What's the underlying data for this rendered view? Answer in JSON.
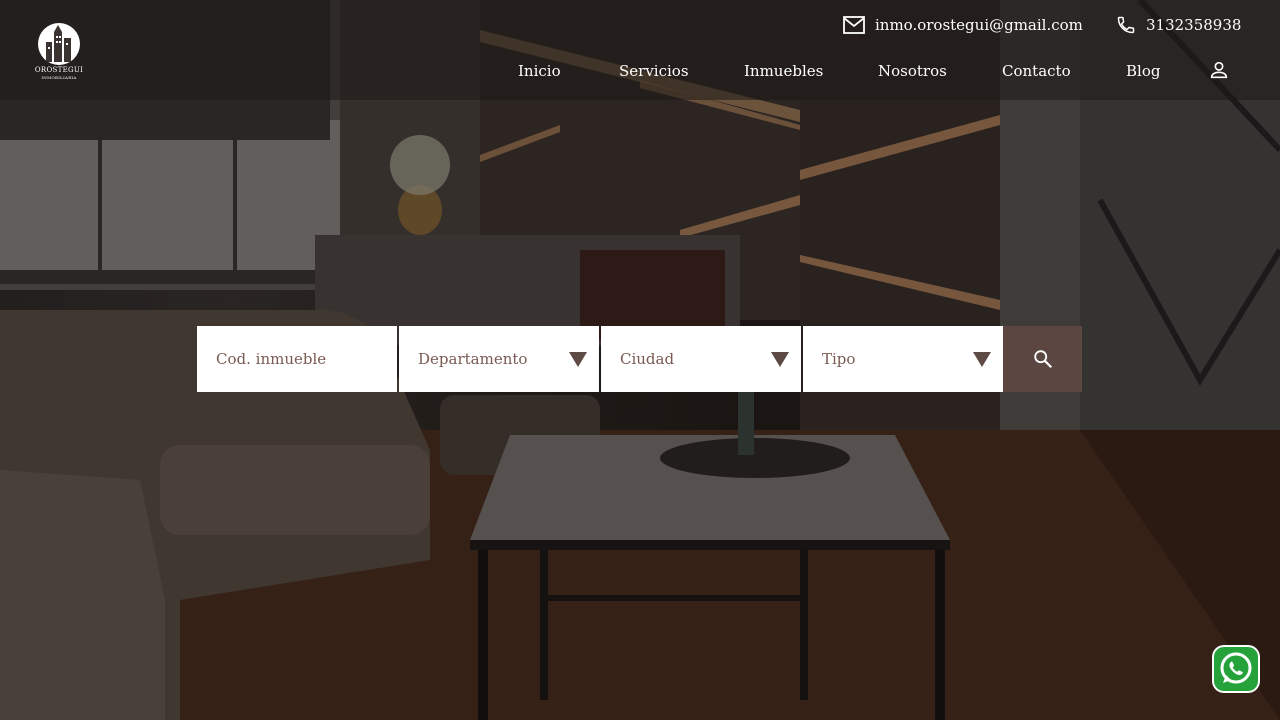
{
  "brand": {
    "name": "OROSTEGUI",
    "subtitle": "INMOBILIARIA"
  },
  "contact": {
    "email": "inmo.orostegui@gmail.com",
    "phone": "3132358938"
  },
  "nav": {
    "items": [
      {
        "label": "Inicio"
      },
      {
        "label": "Servicios"
      },
      {
        "label": "Inmuebles"
      },
      {
        "label": "Nosotros"
      },
      {
        "label": "Contacto"
      },
      {
        "label": "Blog"
      }
    ]
  },
  "search": {
    "code_placeholder": "Cod. inmueble",
    "department_label": "Departamento",
    "city_label": "Ciudad",
    "type_label": "Tipo"
  },
  "icons": {
    "email": "mail-icon",
    "phone": "phone-icon",
    "user": "user-icon",
    "search": "search-icon",
    "whatsapp": "whatsapp-icon"
  },
  "colors": {
    "search_button": "#5b4642",
    "field_text": "#7a5a52",
    "caret": "#5d4a44",
    "whatsapp": "#25a33a"
  }
}
